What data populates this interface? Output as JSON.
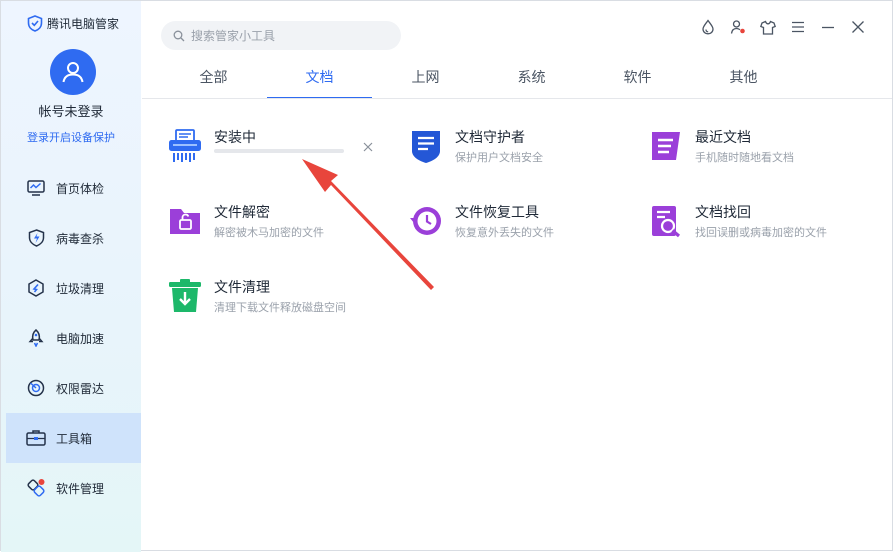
{
  "sidebar": {
    "brand": "腾讯电脑管家",
    "account_name": "帐号未登录",
    "login_link": "登录开启设备保护",
    "items": [
      {
        "label": "首页体检",
        "icon": "monitor-check-icon"
      },
      {
        "label": "病毒查杀",
        "icon": "shield-bolt-icon"
      },
      {
        "label": "垃圾清理",
        "icon": "hexagon-clean-icon"
      },
      {
        "label": "电脑加速",
        "icon": "rocket-icon"
      },
      {
        "label": "权限雷达",
        "icon": "radar-icon"
      },
      {
        "label": "工具箱",
        "icon": "toolbox-icon"
      },
      {
        "label": "软件管理",
        "icon": "apps-icon"
      }
    ],
    "active_index": 5
  },
  "search": {
    "placeholder": "搜索管家小工具",
    "value": ""
  },
  "window_controls": [
    "drop-icon",
    "user-alert-icon",
    "shirt-icon",
    "menu-icon",
    "minimize-icon",
    "close-icon"
  ],
  "tabs": [
    {
      "label": "全部"
    },
    {
      "label": "文档"
    },
    {
      "label": "上网"
    },
    {
      "label": "系统"
    },
    {
      "label": "软件"
    },
    {
      "label": "其他"
    }
  ],
  "active_tab": 1,
  "tools": {
    "shredder": {
      "name": "安装中",
      "progress": 0.0,
      "icon": "file-shredder-icon"
    },
    "doc_guard": {
      "name": "文档守护者",
      "desc": "保护用户文档安全",
      "icon": "document-shield-icon"
    },
    "recent_docs": {
      "name": "最近文档",
      "desc": "手机随时随地看文档",
      "icon": "recent-docs-icon"
    },
    "decrypt": {
      "name": "文件解密",
      "desc": "解密被木马加密的文件",
      "icon": "folder-unlock-icon"
    },
    "restore": {
      "name": "文件恢复工具",
      "desc": "恢复意外丢失的文件",
      "icon": "clock-restore-icon"
    },
    "find_doc": {
      "name": "文档找回",
      "desc": "找回误删或病毒加密的文件",
      "icon": "doc-search-icon"
    },
    "clean": {
      "name": "文件清理",
      "desc": "清理下载文件释放磁盘空间",
      "icon": "trash-download-icon"
    }
  },
  "colors": {
    "accent": "#2f6bf1",
    "arrow": "#e8453c",
    "active_nav_bg": "#cfe3fb"
  }
}
